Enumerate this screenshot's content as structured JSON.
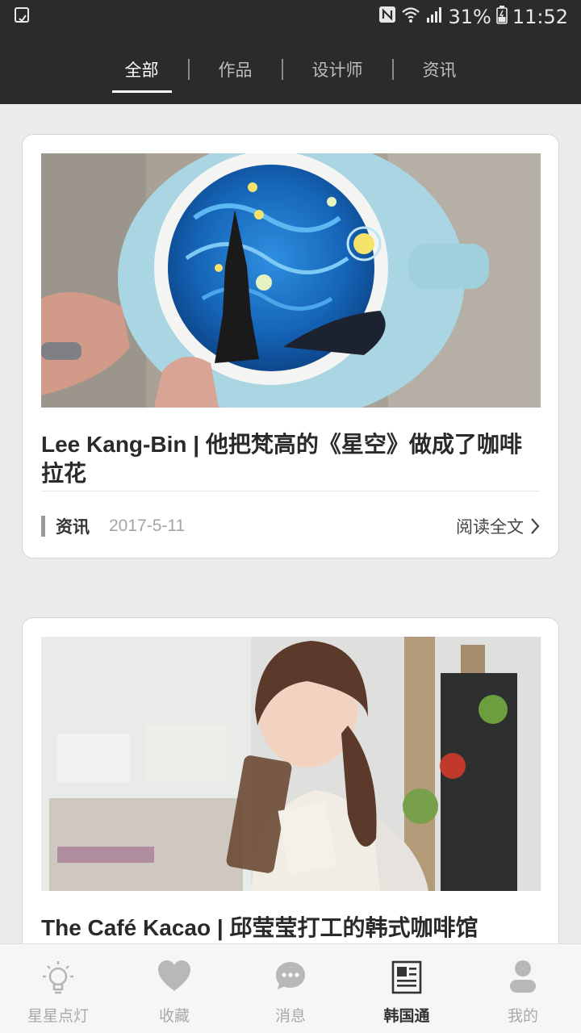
{
  "status_bar": {
    "battery": "31%",
    "time": "11:52"
  },
  "tabs": [
    {
      "label": "全部"
    },
    {
      "label": "作品"
    },
    {
      "label": "设计师"
    },
    {
      "label": "资讯"
    }
  ],
  "cards": [
    {
      "title": "Lee Kang-Bin | 他把梵高的《星空》做成了咖啡拉花",
      "category": "资讯",
      "date": "2017-5-11",
      "read_more": "阅读全文"
    },
    {
      "title": "The Café Kacao | 邱莹莹打工的韩式咖啡馆"
    }
  ],
  "bottom_nav": [
    {
      "label": "星星点灯",
      "icon": "lightbulb-icon"
    },
    {
      "label": "收藏",
      "icon": "heart-icon"
    },
    {
      "label": "消息",
      "icon": "chat-bubble-icon"
    },
    {
      "label": "韩国通",
      "icon": "newspaper-icon"
    },
    {
      "label": "我的",
      "icon": "person-icon"
    }
  ],
  "colors": {
    "header_bg": "#2b2b2b",
    "page_bg": "#ebebeb",
    "active_text": "#333333",
    "inactive_nav": "#a9a9a9"
  }
}
